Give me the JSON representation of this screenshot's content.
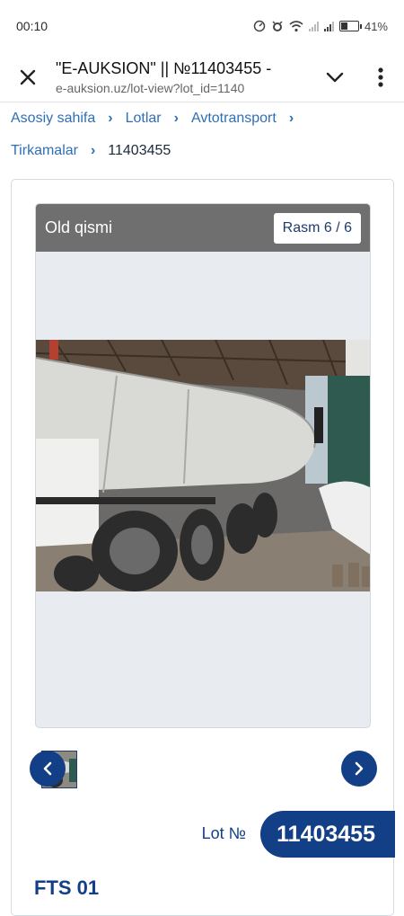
{
  "status": {
    "time": "00:10",
    "battery": "41%",
    "battery_level": 0.41
  },
  "browser": {
    "title": "\"E-AUKSION\" || №11403455 -",
    "url": "e-auksion.uz/lot-view?lot_id=1140"
  },
  "breadcrumb": [
    "Asosiy sahifa",
    "Lotlar",
    "Avtotransport",
    "Tirkamalar"
  ],
  "breadcrumb_current": "11403455",
  "gallery": {
    "caption": "Old qismi",
    "counter": "Rasm 6 / 6"
  },
  "lot": {
    "label": "Lot №",
    "number": "11403455",
    "title": "FTS 01"
  },
  "icons": {
    "close": "close-icon",
    "expand": "chevron-down-icon",
    "menu": "more-vert-icon",
    "prev": "chevron-left-icon",
    "next": "chevron-right-icon"
  },
  "colors": {
    "accent": "#123f86",
    "link": "#2e6fb6"
  }
}
